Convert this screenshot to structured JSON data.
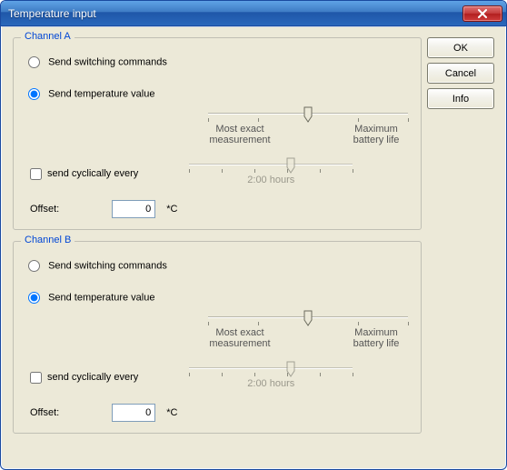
{
  "window": {
    "title": "Temperature input"
  },
  "buttons": {
    "ok": "OK",
    "cancel": "Cancel",
    "info": "Info"
  },
  "shared": {
    "slider_left": "Most exact measurement",
    "slider_right": "Maximum battery life",
    "offset_label": "Offset:",
    "offset_unit": "*C"
  },
  "channels": [
    {
      "key": "A",
      "legend": "Channel A",
      "radio_switching": "Send switching commands",
      "radio_temp": "Send temperature value",
      "selected": "temp",
      "slider_pos_pct": 50,
      "cycle_label": "send cyclically every",
      "cycle_checked": false,
      "cycle_slider_pos_pct": 62,
      "cycle_value": "2:00 hours",
      "offset": "0"
    },
    {
      "key": "B",
      "legend": "Channel B",
      "radio_switching": "Send switching commands",
      "radio_temp": "Send temperature value",
      "selected": "temp",
      "slider_pos_pct": 50,
      "cycle_label": "send cyclically every",
      "cycle_checked": false,
      "cycle_slider_pos_pct": 62,
      "cycle_value": "2:00 hours",
      "offset": "0"
    }
  ]
}
